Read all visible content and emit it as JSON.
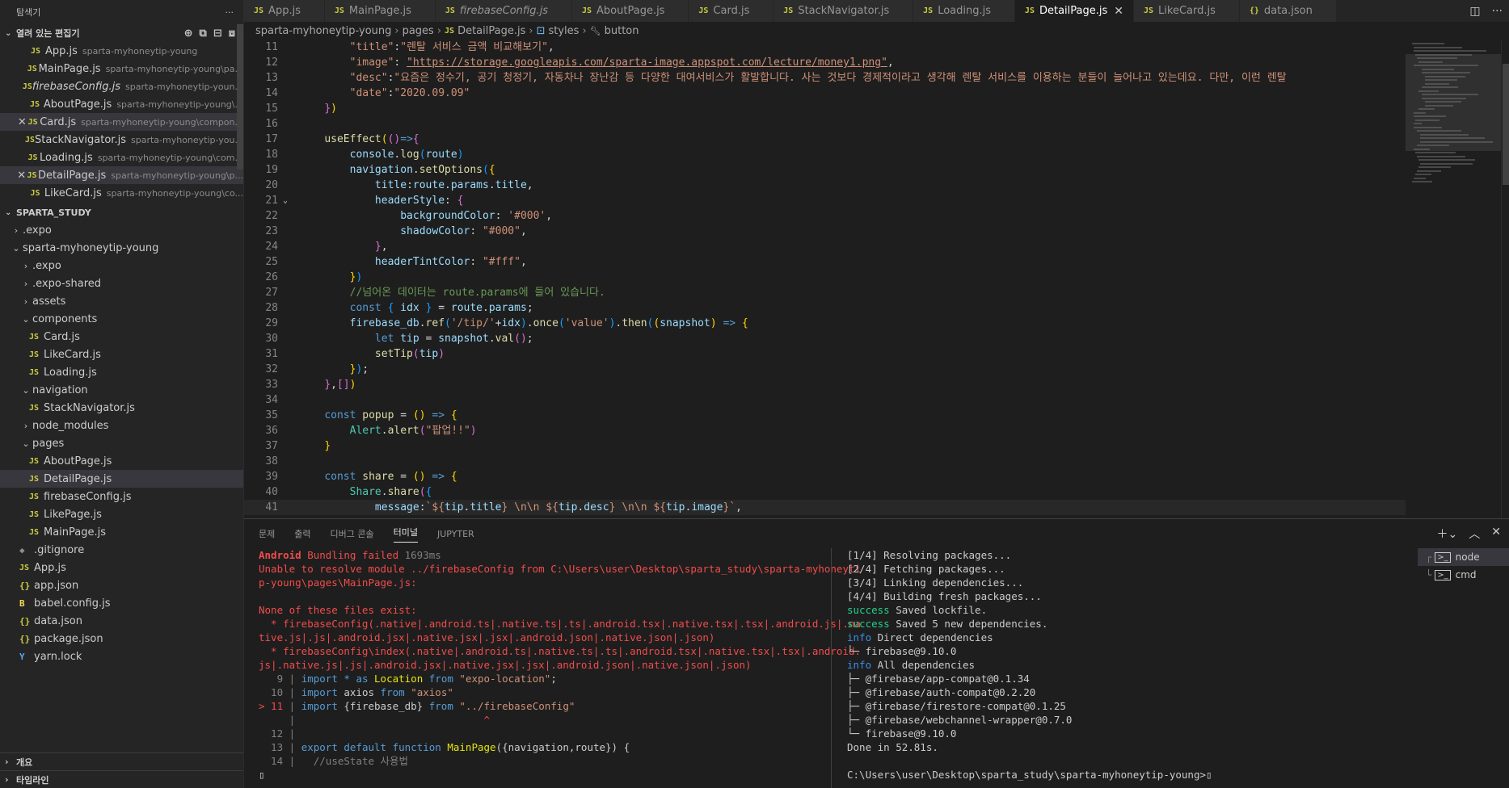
{
  "sidebar": {
    "title": "탐색기",
    "more": "···",
    "open_editors_label": "열려 있는 편집기",
    "open_editors": [
      {
        "name": "App.js",
        "path": "sparta-myhoneytip-young",
        "italic": false,
        "close": false
      },
      {
        "name": "MainPage.js",
        "path": "sparta-myhoneytip-young\\pa...",
        "italic": false,
        "close": false
      },
      {
        "name": "firebaseConfig.js",
        "path": "sparta-myhoneytip-youn...",
        "italic": true,
        "close": false
      },
      {
        "name": "AboutPage.js",
        "path": "sparta-myhoneytip-young\\...",
        "italic": false,
        "close": false
      },
      {
        "name": "Card.js",
        "path": "sparta-myhoneytip-young\\compon...",
        "italic": false,
        "close": true
      },
      {
        "name": "StackNavigator.js",
        "path": "sparta-myhoneytip-you...",
        "italic": false,
        "close": false
      },
      {
        "name": "Loading.js",
        "path": "sparta-myhoneytip-young\\com...",
        "italic": false,
        "close": false
      },
      {
        "name": "DetailPage.js",
        "path": "sparta-myhoneytip-young\\p...",
        "italic": false,
        "close": true
      },
      {
        "name": "LikeCard.js",
        "path": "sparta-myhoneytip-young\\co...",
        "italic": false,
        "close": false
      }
    ],
    "project_label": "SPARTA_STUDY",
    "tree": [
      {
        "indent": 1,
        "chev": "›",
        "icon": "",
        "name": ".expo"
      },
      {
        "indent": 1,
        "chev": "⌄",
        "icon": "",
        "name": "sparta-myhoneytip-young"
      },
      {
        "indent": 2,
        "chev": "›",
        "icon": "",
        "name": ".expo"
      },
      {
        "indent": 2,
        "chev": "›",
        "icon": "",
        "name": ".expo-shared"
      },
      {
        "indent": 2,
        "chev": "›",
        "icon": "",
        "name": "assets"
      },
      {
        "indent": 2,
        "chev": "⌄",
        "icon": "",
        "name": "components"
      },
      {
        "indent": 3,
        "chev": "",
        "icon": "JS",
        "name": "Card.js"
      },
      {
        "indent": 3,
        "chev": "",
        "icon": "JS",
        "name": "LikeCard.js"
      },
      {
        "indent": 3,
        "chev": "",
        "icon": "JS",
        "name": "Loading.js"
      },
      {
        "indent": 2,
        "chev": "⌄",
        "icon": "",
        "name": "navigation"
      },
      {
        "indent": 3,
        "chev": "",
        "icon": "JS",
        "name": "StackNavigator.js"
      },
      {
        "indent": 2,
        "chev": "›",
        "icon": "",
        "name": "node_modules"
      },
      {
        "indent": 2,
        "chev": "⌄",
        "icon": "",
        "name": "pages"
      },
      {
        "indent": 3,
        "chev": "",
        "icon": "JS",
        "name": "AboutPage.js"
      },
      {
        "indent": 3,
        "chev": "",
        "icon": "JS",
        "name": "DetailPage.js",
        "selected": true
      },
      {
        "indent": 3,
        "chev": "",
        "icon": "JS",
        "name": "firebaseConfig.js"
      },
      {
        "indent": 3,
        "chev": "",
        "icon": "JS",
        "name": "LikePage.js"
      },
      {
        "indent": 3,
        "chev": "",
        "icon": "JS",
        "name": "MainPage.js"
      },
      {
        "indent": 2,
        "chev": "",
        "icon": "◆",
        "name": ".gitignore"
      },
      {
        "indent": 2,
        "chev": "",
        "icon": "JS",
        "name": "App.js"
      },
      {
        "indent": 2,
        "chev": "",
        "icon": "{}",
        "name": "app.json"
      },
      {
        "indent": 2,
        "chev": "",
        "icon": "B",
        "name": "babel.config.js"
      },
      {
        "indent": 2,
        "chev": "",
        "icon": "{}",
        "name": "data.json"
      },
      {
        "indent": 2,
        "chev": "",
        "icon": "{}",
        "name": "package.json"
      },
      {
        "indent": 2,
        "chev": "",
        "icon": "Y",
        "name": "yarn.lock"
      }
    ],
    "outline_label": "개요",
    "timeline_label": "타임라인"
  },
  "tabs": [
    {
      "icon": "JS",
      "label": "App.js",
      "italic": false,
      "active": false
    },
    {
      "icon": "JS",
      "label": "MainPage.js",
      "italic": false,
      "active": false
    },
    {
      "icon": "JS",
      "label": "firebaseConfig.js",
      "italic": true,
      "active": false
    },
    {
      "icon": "JS",
      "label": "AboutPage.js",
      "italic": false,
      "active": false
    },
    {
      "icon": "JS",
      "label": "Card.js",
      "italic": false,
      "active": false
    },
    {
      "icon": "JS",
      "label": "StackNavigator.js",
      "italic": false,
      "active": false
    },
    {
      "icon": "JS",
      "label": "Loading.js",
      "italic": false,
      "active": false
    },
    {
      "icon": "JS",
      "label": "DetailPage.js",
      "italic": false,
      "active": true
    },
    {
      "icon": "JS",
      "label": "LikeCard.js",
      "italic": false,
      "active": false
    },
    {
      "icon": "{}",
      "label": "data.json",
      "italic": false,
      "active": false
    }
  ],
  "breadcrumb": [
    "sparta-myhoneytip-young",
    "pages",
    "DetailPage.js",
    "styles",
    "button"
  ],
  "editor": {
    "lines": [
      {
        "n": "11",
        "html": "        <span class='s'>\"title\"</span>:<span class='s'>\"렌탈 서비스 금액 비교해보기\"</span>,"
      },
      {
        "n": "12",
        "html": "        <span class='s'>\"image\"</span>: <span class='u'>\"https://storage.googleapis.com/sparta-image.appspot.com/lecture/money1.png\"</span>,"
      },
      {
        "n": "13",
        "html": "        <span class='s'>\"desc\"</span>:<span class='s'>\"요즘은 정수기, 공기 청정기, 자동차나 장난감 등 다양한 대여서비스가 활발합니다. 사는 것보다 경제적이라고 생각해 렌탈 서비스를 이용하는 분들이 늘어나고 있는데요. 다만, 이런 렌탈</span>"
      },
      {
        "n": "14",
        "html": "        <span class='s'>\"date\"</span>:<span class='s'>\"2020.09.09\"</span>"
      },
      {
        "n": "15",
        "html": "    <span class='br2'>}</span><span class='br1'>)</span>"
      },
      {
        "n": "16",
        "html": ""
      },
      {
        "n": "17",
        "html": "    <span class='f'>useEffect</span><span class='br1'>(</span><span class='br2'>()</span><span class='k'>=&gt;</span><span class='br2'>{</span>"
      },
      {
        "n": "18",
        "html": "        <span class='v'>console</span>.<span class='f'>log</span><span class='br3'>(</span><span class='v'>route</span><span class='br3'>)</span>"
      },
      {
        "n": "19",
        "html": "        <span class='v'>navigation</span>.<span class='f'>setOptions</span><span class='br3'>(</span><span class='br1'>{</span>"
      },
      {
        "n": "20",
        "html": "            <span class='v'>title</span>:<span class='v'>route</span>.<span class='v'>params</span>.<span class='v'>title</span>,"
      },
      {
        "n": "21",
        "fold": "⌄",
        "html": "            <span class='v'>headerStyle</span>: <span class='br2'>{</span>"
      },
      {
        "n": "22",
        "html": "                <span class='v'>backgroundColor</span>: <span class='s'>'#000'</span>,"
      },
      {
        "n": "23",
        "html": "                <span class='v'>shadowColor</span>: <span class='s'>\"#000\"</span>,"
      },
      {
        "n": "24",
        "html": "            <span class='br2'>}</span>,"
      },
      {
        "n": "25",
        "html": "            <span class='v'>headerTintColor</span>: <span class='s'>\"#fff\"</span>,"
      },
      {
        "n": "26",
        "html": "        <span class='br1'>}</span><span class='br3'>)</span>"
      },
      {
        "n": "27",
        "html": "        <span class='c'>//넘어온 데이터는 route.params에 들어 있습니다.</span>"
      },
      {
        "n": "28",
        "html": "        <span class='k'>const</span> <span class='br3'>{</span> <span class='v'>idx</span> <span class='br3'>}</span> = <span class='v'>route</span>.<span class='v'>params</span>;"
      },
      {
        "n": "29",
        "html": "        <span class='v'>firebase_db</span>.<span class='f'>ref</span><span class='br3'>(</span><span class='s'>'/tip/'</span>+<span class='v'>idx</span><span class='br3'>)</span>.<span class='f'>once</span><span class='br3'>(</span><span class='s'>'value'</span><span class='br3'>)</span>.<span class='f'>then</span><span class='br3'>(</span><span class='br1'>(</span><span class='v'>snapshot</span><span class='br1'>)</span> <span class='k'>=&gt;</span> <span class='br1'>{</span>"
      },
      {
        "n": "30",
        "html": "            <span class='k'>let</span> <span class='v'>tip</span> = <span class='v'>snapshot</span>.<span class='f'>val</span><span class='br2'>()</span>;"
      },
      {
        "n": "31",
        "html": "            <span class='f'>setTip</span><span class='br2'>(</span><span class='v'>tip</span><span class='br2'>)</span>"
      },
      {
        "n": "32",
        "html": "        <span class='br1'>}</span><span class='br3'>)</span>;"
      },
      {
        "n": "33",
        "html": "    <span class='br2'>}</span>,<span class='br2'>[]</span><span class='br1'>)</span>"
      },
      {
        "n": "34",
        "html": ""
      },
      {
        "n": "35",
        "html": "    <span class='k'>const</span> <span class='f'>popup</span> = <span class='br1'>()</span> <span class='k'>=&gt;</span> <span class='br1'>{</span>"
      },
      {
        "n": "36",
        "html": "        <span class='cl'>Alert</span>.<span class='f'>alert</span><span class='br2'>(</span><span class='s'>\"팝업!!\"</span><span class='br2'>)</span>"
      },
      {
        "n": "37",
        "html": "    <span class='br1'>}</span>"
      },
      {
        "n": "38",
        "html": ""
      },
      {
        "n": "39",
        "html": "    <span class='k'>const</span> <span class='f'>share</span> = <span class='br1'>()</span> <span class='k'>=&gt;</span> <span class='br1'>{</span>"
      },
      {
        "n": "40",
        "html": "        <span class='cl'>Share</span>.<span class='f'>share</span><span class='br2'>(</span><span class='br3'>{</span>"
      },
      {
        "n": "41",
        "html": "            <span class='v'>message</span>:<span class='s'>`${</span><span class='v'>tip</span>.<span class='v'>title</span><span class='s'>} \\n\\n ${</span><span class='v'>tip</span>.<span class='v'>desc</span><span class='s'>} \\n\\n ${</span><span class='v'>tip</span>.<span class='v'>image</span><span class='s'>}`</span>,",
        "current": true
      }
    ]
  },
  "panel": {
    "tabs": [
      "문제",
      "출력",
      "디버그 콘솔",
      "터미널",
      "JUPYTER"
    ],
    "active_tab": "터미널",
    "terminals": [
      "node",
      "cmd"
    ],
    "left_terminal_html": "<span class='bred'>Android</span><span class='red'> Bundling failed </span><span class='gray'>1693ms</span>\n<span class='red'>Unable to resolve module ../firebaseConfig from C:\\Users\\user\\Desktop\\sparta_study\\sparta-myhoneyti\np-young\\pages\\MainPage.js:</span>\n\n<span class='red'>None of these files exist:\n  * firebaseConfig(.native|.android.ts|.native.ts|.ts|.android.tsx|.native.tsx|.tsx|.android.js|.na\ntive.js|.js|.android.jsx|.native.jsx|.jsx|.android.json|.native.json|.json)\n  * firebaseConfig\\index(.native|.android.ts|.native.ts|.ts|.android.tsx|.native.tsx|.tsx|.android.\njs|.native.js|.js|.android.jsx|.native.jsx|.jsx|.android.json|.native.json|.json)</span>\n<span class='gray'>   9 | </span><span class='k'>import</span> <span class='k'>*</span> <span class='k'>as</span> <span class='yellow'>Location</span> <span class='k'>from</span> <span class='s'>\"expo-location\"</span><span class='white'>;</span>\n<span class='gray'>  10 | </span><span class='k'>import</span> <span class='white'>axios</span> <span class='k'>from</span> <span class='s'>\"axios\"</span>\n<span class='red'>&gt; 11</span><span class='gray'> | </span><span class='k'>import</span> <span class='white'>{firebase_db}</span> <span class='k'>from</span> <span class='s'>\"../firebaseConfig\"</span>\n<span class='gray'>     | </span>                              <span class='red'>^</span>\n<span class='gray'>  12 | </span>\n<span class='gray'>  13 | </span><span class='k'>export</span> <span class='k'>default</span> <span class='k'>function</span> <span class='yellow'>MainPage</span><span class='white'>({navigation,route}) {</span>\n<span class='gray'>  14 | </span><span class='gray'>  //useState 사용법</span>\n<span class='white'>▯</span>",
    "right_terminal_html": "<span class='white'>[1/4] Resolving packages...\n[2/4] Fetching packages...\n[3/4] Linking dependencies...\n[4/4] Building fresh packages...</span>\n<span class='green'>success</span><span class='white'> Saved lockfile.</span>\n<span class='green'>success</span><span class='white'> Saved 5 new dependencies.</span>\n<span class='blue'>info</span><span class='white'> Direct dependencies\n└─ firebase@9.10.0</span>\n<span class='blue'>info</span><span class='white'> All dependencies\n├─ @firebase/app-compat@0.1.34\n├─ @firebase/auth-compat@0.2.20\n├─ @firebase/firestore-compat@0.1.25\n├─ @firebase/webchannel-wrapper@0.7.0\n└─ firebase@9.10.0\nDone in 52.81s.\n\nC:\\Users\\user\\Desktop\\sparta_study\\sparta-myhoneytip-young&gt;▯</span>"
  }
}
